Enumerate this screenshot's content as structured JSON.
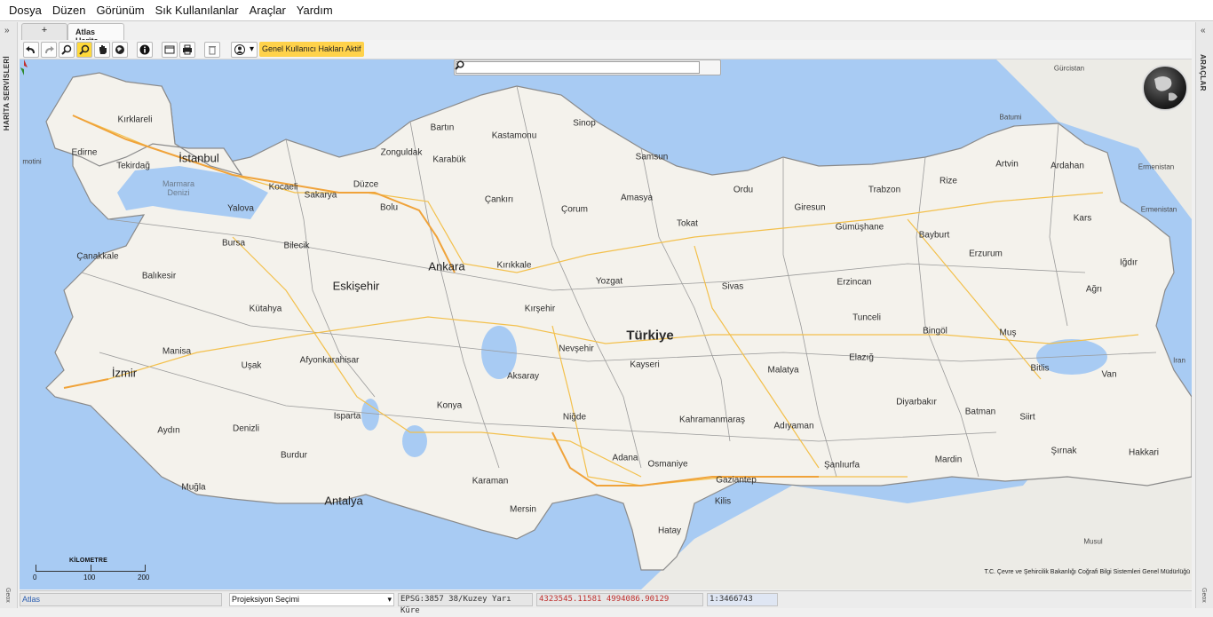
{
  "menu": [
    "Dosya",
    "Düzen",
    "Görünüm",
    "Sık Kullanılanlar",
    "Araçlar",
    "Yardım"
  ],
  "left_panel": {
    "title": "HARİTA SERVİSLERİ",
    "footer": "Geox"
  },
  "right_panel": {
    "title": "ARAÇLAR",
    "footer": "Geox"
  },
  "tabs": [
    {
      "label": "+"
    },
    {
      "label": "Atlas Harita"
    }
  ],
  "toolbar": {
    "buttons": [
      "undo-icon",
      "redo-icon",
      "zoom-in-icon",
      "zoom-out-icon",
      "pan-hand-icon",
      "full-extent-globe-icon",
      "info-icon",
      "window-icon",
      "print-icon",
      "delete-icon",
      "user-icon"
    ],
    "user_rights_label": "Genel Kullanıcı Hakları Aktif"
  },
  "search": {
    "placeholder": "",
    "value": ""
  },
  "map": {
    "country_label": "Türkiye",
    "big_cities": [
      "İstanbul",
      "Ankara",
      "İzmir",
      "Eskişehir",
      "Antalya"
    ],
    "cities": [
      "Kırklareli",
      "Edirne",
      "Tekirdağ",
      "Kocaeli",
      "Sakarya",
      "Düzce",
      "Zonguldak",
      "Bartın",
      "Karabük",
      "Kastamonu",
      "Sinop",
      "Samsun",
      "Ordu",
      "Giresun",
      "Trabzon",
      "Rize",
      "Artvin",
      "Ardahan",
      "Kars",
      "Iğdır",
      "Ağrı",
      "Erzurum",
      "Bayburt",
      "Gümüşhane",
      "Erzincan",
      "Tunceli",
      "Bingöl",
      "Muş",
      "Bitlis",
      "Van",
      "Hakkari",
      "Şırnak",
      "Siirt",
      "Batman",
      "Mardin",
      "Diyarbakır",
      "Elazığ",
      "Malatya",
      "Adıyaman",
      "Şanlıurfa",
      "Gaziantep",
      "Kilis",
      "Osmaniye",
      "Hatay",
      "Adana",
      "Mersin",
      "Karaman",
      "Niğde",
      "Kahramanmaraş",
      "Kayseri",
      "Nevşehir",
      "Aksaray",
      "Kırşehir",
      "Kırıkkale",
      "Yozgat",
      "Sivas",
      "Tokat",
      "Amasya",
      "Çorum",
      "Çankırı",
      "Bolu",
      "Bilecik",
      "Bursa",
      "Yalova",
      "Çanakkale",
      "Balıkesir",
      "Kütahya",
      "Manisa",
      "Uşak",
      "Afyonkarahisar",
      "Aydın",
      "Denizli",
      "Muğla",
      "Burdur",
      "Isparta",
      "Konya"
    ],
    "foreign": [
      "Gürcistan",
      "Ermenistan",
      "Ermenistan",
      "Iran",
      "Musul",
      "Batumi",
      "motini"
    ],
    "sea_label": "Marmara\nDenizi",
    "scale_title": "KİLOMETRE",
    "scale_ticks": [
      "0",
      "100",
      "200"
    ],
    "credit": "T.C. Çevre ve Şehircilik Bakanlığı Coğrafi Bilgi Sistemleri Genel Müdürlüğü"
  },
  "status": {
    "atlas": "Atlas",
    "projection": "Projeksiyon Seçimi",
    "epsg": "EPSG:3857 38/Kuzey Yarı Küre",
    "coords": "4323545.11581 4994086.90129",
    "scale": "1:3466743"
  },
  "colors": {
    "sea": "#a8cbf3",
    "land": "#f4f2ec",
    "roads": "#f3c04c",
    "highway": "#f0a33a",
    "borders": "#8a8a8a",
    "toolbar_active": "#ffd24a"
  }
}
